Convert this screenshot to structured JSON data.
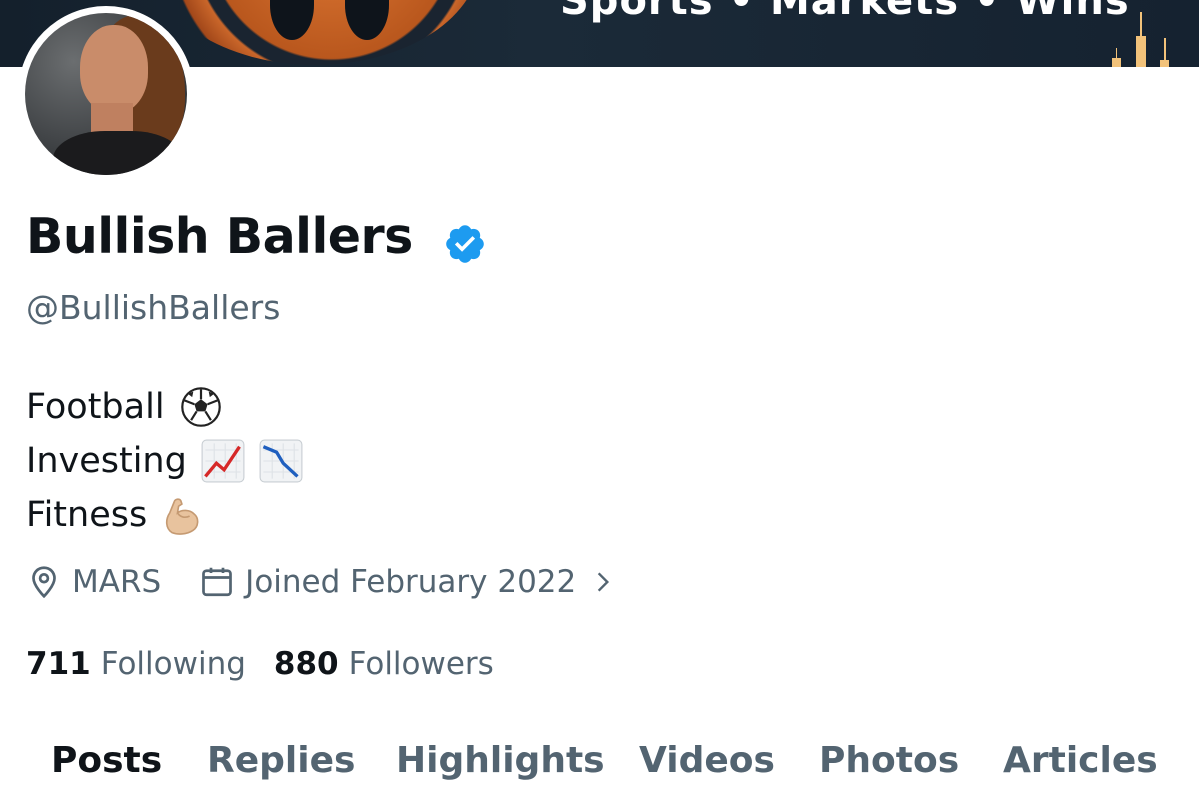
{
  "banner": {
    "tagline": "Sports • Markets • Wins"
  },
  "profile": {
    "name": "Bullish Ballers",
    "verified": true,
    "handle": "@BullishBallers",
    "bio": [
      {
        "text": "Football",
        "emojis": [
          "soccer-ball"
        ]
      },
      {
        "text": "Investing",
        "emojis": [
          "chart-increasing",
          "chart-decreasing"
        ]
      },
      {
        "text": "Fitness",
        "emojis": [
          "flexed-biceps"
        ]
      }
    ],
    "location": "MARS",
    "joined": "Joined February 2022",
    "following_count": "711",
    "following_label": "Following",
    "followers_count": "880",
    "followers_label": "Followers"
  },
  "tabs": [
    {
      "label": "Posts",
      "active": true
    },
    {
      "label": "Replies",
      "active": false
    },
    {
      "label": "Highlights",
      "active": false
    },
    {
      "label": "Videos",
      "active": false
    },
    {
      "label": "Photos",
      "active": false
    },
    {
      "label": "Articles",
      "active": false
    }
  ],
  "colors": {
    "verified": "#1d9bf0",
    "text": "#0f1419",
    "secondary": "#536471"
  }
}
